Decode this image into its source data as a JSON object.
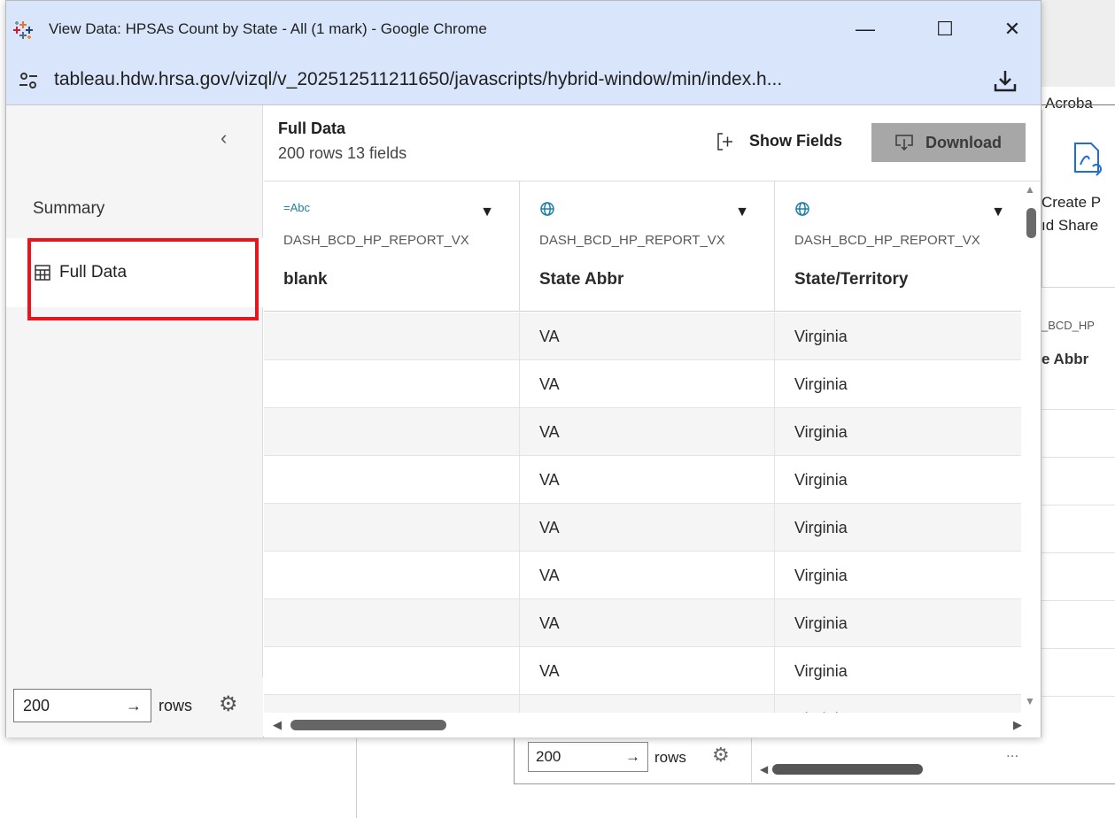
{
  "window": {
    "title": "View Data: HPSAs Count by State - All (1 mark) - Google Chrome",
    "minimize_glyph": "—",
    "maximize_glyph": "☐",
    "close_glyph": "✕"
  },
  "address_bar": {
    "url": "tableau.hdw.hrsa.gov/vizql/v_202512511211650/javascripts/hybrid-window/min/index.h..."
  },
  "sidebar": {
    "collapse_glyph": "‹",
    "summary_label": "Summary",
    "full_data_label": "Full Data",
    "rows_value": "200",
    "rows_arrow": "→",
    "rows_label": "rows"
  },
  "main": {
    "title": "Full Data",
    "subtitle": "200 rows  13 fields",
    "show_fields_label": "Show Fields",
    "download_label": "Download"
  },
  "columns": [
    {
      "type": "=Abc",
      "source": "DASH_BCD_HP_REPORT_VX",
      "name": "blank",
      "icon": "text-type-icon"
    },
    {
      "type": "",
      "source": "DASH_BCD_HP_REPORT_VX",
      "name": "State Abbr",
      "icon": "globe-icon"
    },
    {
      "type": "",
      "source": "DASH_BCD_HP_REPORT_VX",
      "name": "State/Territory",
      "icon": "globe-icon"
    }
  ],
  "rows": [
    [
      "",
      "VA",
      "Virginia"
    ],
    [
      "",
      "VA",
      "Virginia"
    ],
    [
      "",
      "VA",
      "Virginia"
    ],
    [
      "",
      "VA",
      "Virginia"
    ],
    [
      "",
      "VA",
      "Virginia"
    ],
    [
      "",
      "VA",
      "Virginia"
    ],
    [
      "",
      "VA",
      "Virginia"
    ],
    [
      "",
      "VA",
      "Virginia"
    ],
    [
      "",
      "VA",
      "Virginia"
    ]
  ],
  "background": {
    "acrobat_label": "Acroba",
    "create_line1": "Create P",
    "create_line2": "ıd Share",
    "field_source": "_BCD_HP",
    "field_name": "e Abbr",
    "rows_value": "200",
    "rows_arrow": "→",
    "rows_label": "rows",
    "ellipsis": "..."
  },
  "colors": {
    "titlebar": "#d9e5fb",
    "highlight": "#e8161a",
    "download_button": "#a7a7a7",
    "type_label": "#1d7fa8"
  }
}
